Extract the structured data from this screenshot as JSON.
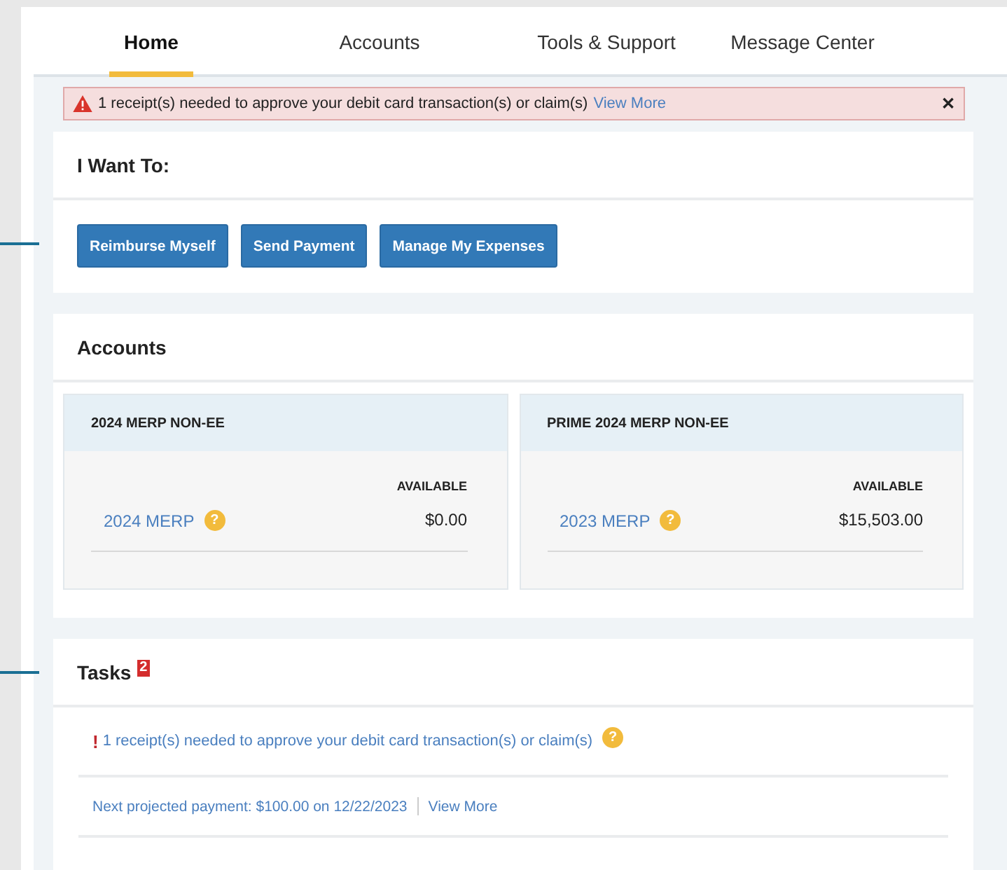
{
  "tabs": [
    {
      "label": "Home",
      "selected": true
    },
    {
      "label": "Accounts",
      "selected": false
    },
    {
      "label": "Tools & Support",
      "selected": false
    },
    {
      "label": "Message Center",
      "selected": false
    }
  ],
  "alert": {
    "text": "1 receipt(s) needed to approve your debit card transaction(s) or claim(s)",
    "link": "View More",
    "close": "✕"
  },
  "i_want_to": {
    "title": "I Want To:",
    "buttons": [
      "Reimburse Myself",
      "Send Payment",
      "Manage My Expenses"
    ]
  },
  "accounts": {
    "title": "Accounts",
    "cards": [
      {
        "heading": "2024 MERP NON-EE",
        "column": "AVAILABLE",
        "name": "2024 MERP",
        "help": "?",
        "amount": "$0.00"
      },
      {
        "heading": "PRIME 2024 MERP NON-EE",
        "column": "AVAILABLE",
        "name": "2023 MERP",
        "help": "?",
        "amount": "$15,503.00"
      }
    ]
  },
  "tasks": {
    "title": "Tasks",
    "count": "2",
    "items": [
      {
        "kind": "alert",
        "mark": "!",
        "text": "1 receipt(s) needed to approve your debit card transaction(s) or claim(s)",
        "help": "?"
      },
      {
        "kind": "info",
        "text": "Next projected payment: $100.00 on 12/22/2023",
        "link": "View More"
      }
    ]
  }
}
